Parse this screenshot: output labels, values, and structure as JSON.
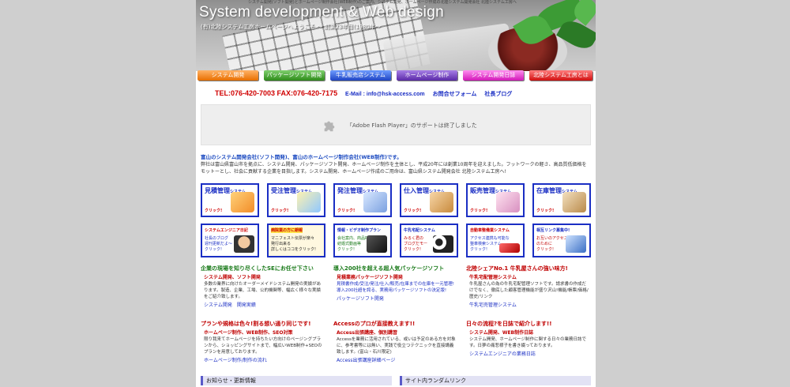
{
  "header": {
    "tagline": "システム開発(ソフト開発)とホームページ制作会社(WEB制作)のご案内。システム開発、ホームページ作成の北陸システム開発会社 北陸システム工房へ",
    "title": "System development & Web design",
    "subtitle": "(有)北陸システム工房ホームページへようこそ  〜 創業23年目(1980年〜"
  },
  "nav": {
    "items": [
      {
        "label": "システム開発"
      },
      {
        "label": "パッケージソフト開発"
      },
      {
        "label": "牛乳販売店システム"
      },
      {
        "label": "ホームページ制作"
      },
      {
        "label": "システム開発日誌"
      },
      {
        "label": "北陸システム工房とは"
      }
    ]
  },
  "contact": {
    "phone": "TEL:076-420-7003  FAX:076-420-7175",
    "email": "E-Mail : info@hsk-access.com",
    "form_link": "お問合せフォーム",
    "blog_link": "社長ブログ"
  },
  "flash": {
    "message": "「Adobe Flash Player」のサポートは終了しました"
  },
  "intro": {
    "heading": "富山のシステム開発会社(ソフト開発)、富山のホームページ制作会社(WEB制作)です。",
    "body": "弊社は富山県富山市を拠点に、システム開発、パッケージソフト開発、ホームページ制作を主体とし、平成20年には創業10周年を迎えました。フットワークの軽さ、高品質低価格をモットーとし、社会に貢献する企業を目指します。システム開発、ホームページ作成のご用命は、富山県システム開発会社 北陸システム工房へ!"
  },
  "banners_row1": [
    {
      "title": "見積管理",
      "suffix": "システム",
      "click": "クリック!"
    },
    {
      "title": "受注管理",
      "suffix": "システム",
      "click": "クリック!"
    },
    {
      "title": "発注管理",
      "suffix": "システム",
      "click": "クリック!"
    },
    {
      "title": "仕入管理",
      "suffix": "システム",
      "click": "クリック!"
    },
    {
      "title": "販売管理",
      "suffix": "システム",
      "click": "クリック!"
    },
    {
      "title": "在庫管理",
      "suffix": "システム",
      "click": "クリック!"
    }
  ],
  "banners_row2": [
    {
      "title": "システムエンジニア日記",
      "body": "社長のブログ\n週刊更新だよ〜\nクリック!"
    },
    {
      "title": "病院業の方に朗報",
      "body": "マニフェスト伝票が楽々\n発行出来る\n詳しくはココをクリック!"
    },
    {
      "title": "情報・ビデオ制作プラン",
      "body": "会社案内、商品PR、お店PR\n結婚式動画等\nクリック!"
    },
    {
      "title": "牛乳宅配システム",
      "body": "みるく君の\nブログだモー\nクリック!"
    },
    {
      "title": "自動車整備業システム",
      "body": "アクセス連携も可能な\n整車検索システム\nクリック!"
    },
    {
      "title": "相互リンク募集中!",
      "body": "お互いのアクセスアップ\nのために\nクリック!"
    }
  ],
  "sections": [
    {
      "heading": "企業の現場を知り尽くしたSEにお任せ下さい",
      "sub": "システム開発、ソフト開発",
      "text": "多数の業界に向けたオーダーメイドシステム開発の実績があります。製造、企業、工場、公的機関等、幅広く様々な実績をご紹介致します。",
      "links": [
        "システム開発",
        "開発実績"
      ]
    },
    {
      "heading": "導入200社を超える超人気パッケージソフト",
      "sub": "見積業務パッケージソフト開発",
      "text": "見積書作成/受注/発注/仕入/販売/在庫までの在庫を一元管理!導入200社超を誇る、実務用パッケージソフトの決定版!",
      "links": [
        "パッケージソフト開発"
      ]
    },
    {
      "heading": "北陸シェアNo.1 牛乳屋さんの強い味方!",
      "sub": "牛乳宅配管理システム",
      "text": "牛乳屋さんの為の牛乳宅配管理ソフトです。請求書の作成だけでなく、徹底した顧客管理機能が盛り沢山!機能/帳票/価格/歴史/リンク",
      "links": [
        "牛乳宅売管理システム"
      ]
    },
    {
      "heading": "プランや規格は色々!割る想い通り同じです!",
      "sub": "ホームページ制作、WEB制作、SEO対策",
      "text": "限り我来てホームページを持ちたい方向けのページングプランから、ショッピングサイトまで、幅広いWEB制作+SEOのプランを用意しております。",
      "links": [
        "ホームページ制作/制作の流れ"
      ]
    },
    {
      "heading": "Accessのプロが直接教えます!!",
      "sub": "Access出張講座、個別講習",
      "text": "Accessを業務に活用されている、或いは予定のある方を対象に、参考書等には無い、実践で役立つテクニックを直接講義致します。(富山・石川限定)",
      "links": [
        "Access出張講座詳細ページ"
      ]
    },
    {
      "heading": "日々の流程?を日誌で紹介します!!",
      "sub": "システム開発、WEB制作日誌",
      "text": "システム開発、ホームページ制作に関する日々の業務日誌です。日夢の痛悲様子を書き綴っております。",
      "links": [
        "システムエンジニアの業務日誌"
      ]
    }
  ],
  "bottom": {
    "news": "お知らせ・更新情報",
    "random_links": "サイト内ランダムリンク"
  }
}
